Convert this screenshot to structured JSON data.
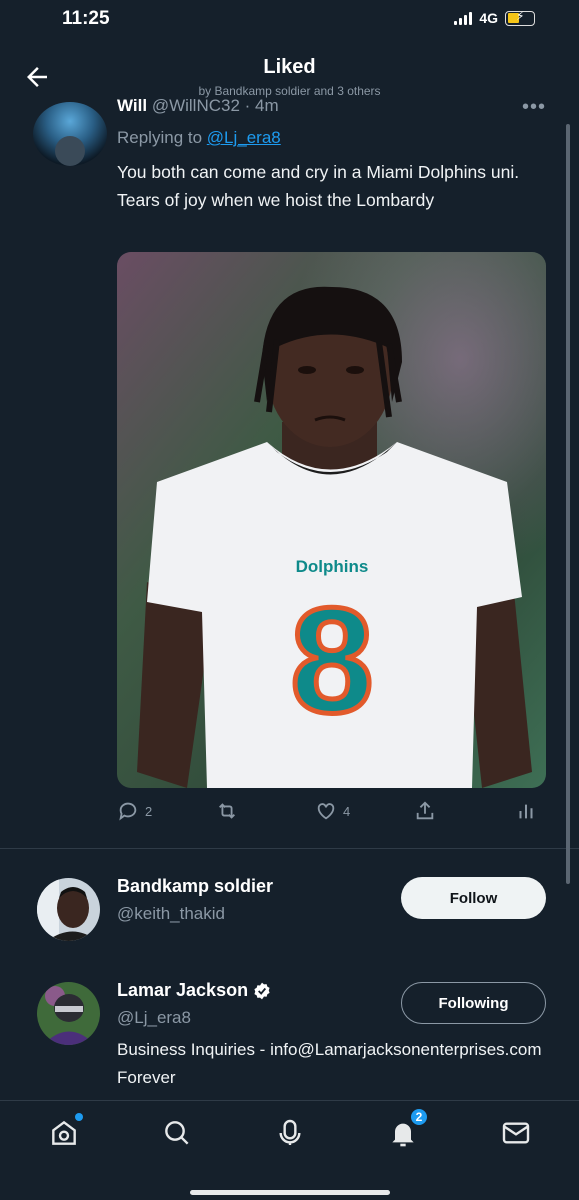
{
  "status": {
    "time": "11:25",
    "network": "4G"
  },
  "header": {
    "title": "Liked",
    "subtitle": "by Bandkamp  soldier and 3 others"
  },
  "tweet": {
    "author_name": "Will",
    "author_handle": "@WillNC32",
    "time": "4m",
    "replying_prefix": "Replying to ",
    "replying_to": "@Lj_era8",
    "text": "You both can come and cry in a Miami Dolphins uni. Tears of joy when we hoist the Lombardy",
    "media": {
      "jersey_brand": "Dolphins",
      "jersey_number": "8"
    },
    "actions": {
      "replies": "2",
      "retweets": "",
      "likes": "4"
    }
  },
  "users": [
    {
      "name": "Bandkamp  soldier",
      "handle": "@keith_thakid",
      "button": "Follow",
      "verified": false
    },
    {
      "name": "Lamar Jackson",
      "handle": "@Lj_era8",
      "button": "Following",
      "verified": true,
      "bio": "Business Inquiries - info@Lamarjacksonenterprises.com Forever"
    }
  ],
  "tabbar": {
    "notifications_count": "2"
  },
  "colors": {
    "background": "#15202b",
    "accent": "#1d9bf0",
    "text_secondary": "#8b98a5",
    "jersey_teal": "#0e8a8a",
    "jersey_orange": "#e25a2b"
  },
  "icons": [
    "back-arrow-icon",
    "more-icon",
    "reply-icon",
    "retweet-icon",
    "like-icon",
    "share-icon",
    "analytics-icon",
    "verified-icon",
    "home-icon",
    "search-icon",
    "spaces-icon",
    "notifications-icon",
    "messages-icon"
  ]
}
